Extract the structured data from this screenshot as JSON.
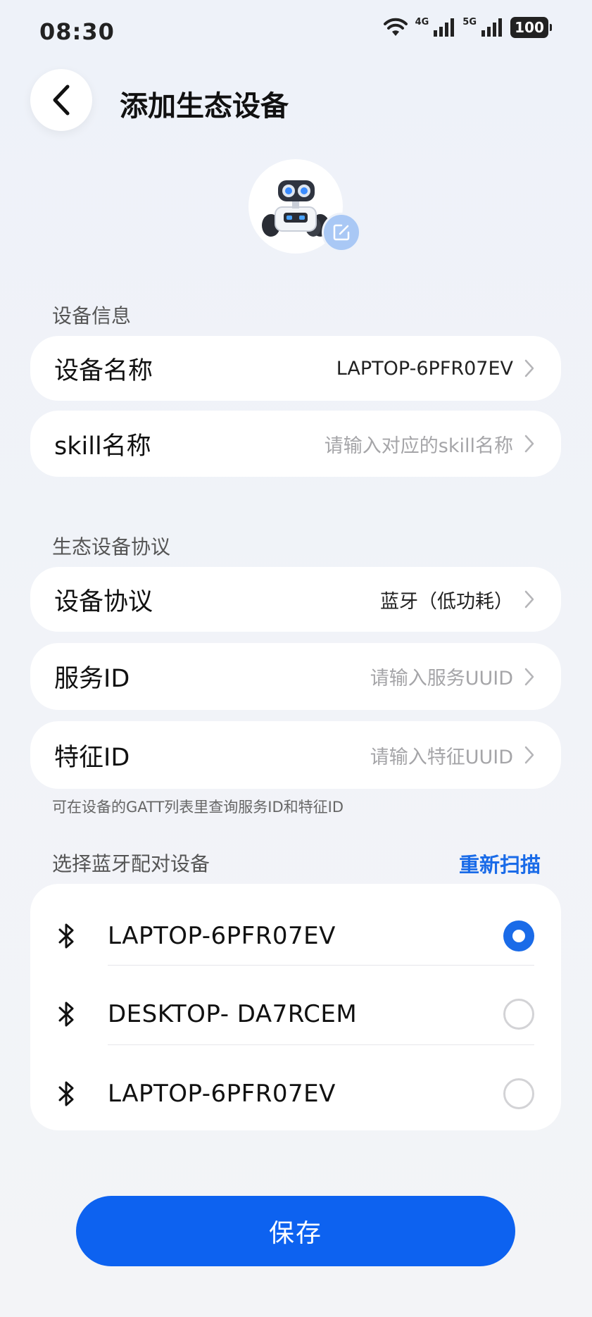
{
  "status_bar": {
    "time": "08:30",
    "net1": "4G",
    "net2": "5G",
    "battery": "100"
  },
  "header": {
    "title": "添加生态设备"
  },
  "device_info": {
    "section_label": "设备信息",
    "name_label": "设备名称",
    "name_value": "LAPTOP-6PFR07EV",
    "skill_label": "skill名称",
    "skill_placeholder": "请输入对应的skill名称"
  },
  "protocol": {
    "section_label": "生态设备协议",
    "protocol_label": "设备协议",
    "protocol_value": "蓝牙（低功耗）",
    "service_label": "服务ID",
    "service_placeholder": "请输入服务UUID",
    "feature_label": "特征ID",
    "feature_placeholder": "请输入特征UUID",
    "hint": "可在设备的GATT列表里查询服务ID和特征ID"
  },
  "bluetooth": {
    "section_label": "选择蓝牙配对设备",
    "rescan_label": "重新扫描",
    "devices": [
      {
        "name": "LAPTOP-6PFR07EV",
        "selected": true
      },
      {
        "name": "DESKTOP- DA7RCEM",
        "selected": false
      },
      {
        "name": "LAPTOP-6PFR07EV",
        "selected": false
      }
    ]
  },
  "actions": {
    "save_label": "保存"
  },
  "colors": {
    "accent": "#0d62f0",
    "link": "#1a6be8",
    "placeholder": "#a5a5a8"
  }
}
